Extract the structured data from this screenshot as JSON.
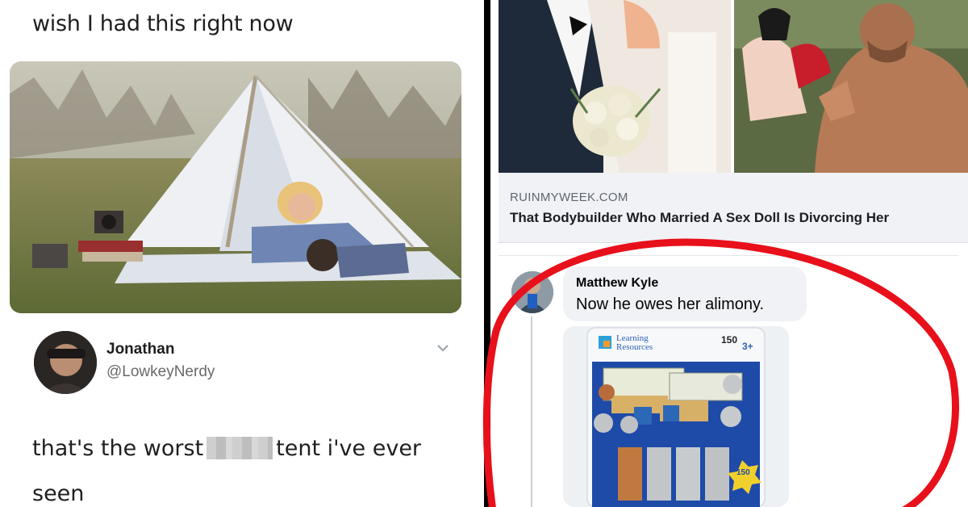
{
  "tweet": {
    "top_text": "wish I had this right now",
    "author_name": "Jonathan",
    "author_handle": "@LowkeyNerdy",
    "reply_before": "that's the worst",
    "reply_after": "tent i've ever",
    "reply_line2": "seen"
  },
  "facebook": {
    "link_domain": "RUINMYWEEK.COM",
    "link_title": "That Bodybuilder Who Married A Sex Doll Is Divorcing Her",
    "comment_author": "Matthew Kyle",
    "comment_text": "Now he owes her alimony.",
    "product": {
      "brand_line1": "Learning",
      "brand_line2": "Resources",
      "count": "150",
      "age": "3+",
      "sticker_count": "150"
    }
  },
  "colors": {
    "annotation_red": "#e8101a",
    "fb_bubble": "#f0f2f5",
    "link_card_bg": "#f0f2f5"
  },
  "icons": {
    "chevron": "chevron-down-icon"
  }
}
